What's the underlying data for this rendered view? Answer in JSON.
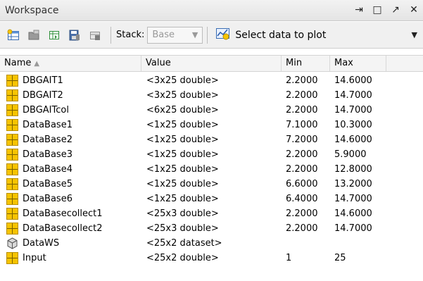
{
  "window": {
    "title": "Workspace",
    "controls": [
      "⇥",
      "□",
      "↗",
      "✕"
    ]
  },
  "toolbar": {
    "icons": [
      "new-variable-icon",
      "open-file-icon",
      "import-data-icon",
      "save-icon",
      "delete-icon"
    ],
    "stack_label": "Stack:",
    "stack_value": "Base",
    "plot_label": "Select data to plot"
  },
  "table": {
    "columns": {
      "name": "Name",
      "value": "Value",
      "min": "Min",
      "max": "Max"
    },
    "rows": [
      {
        "name": "DBGAIT1",
        "value": "<3x25 double>",
        "min": "2.2000",
        "max": "14.6000",
        "icon": "matrix-icon"
      },
      {
        "name": "DBGAIT2",
        "value": "<3x25 double>",
        "min": "2.2000",
        "max": "14.7000",
        "icon": "matrix-icon"
      },
      {
        "name": "DBGAITcol",
        "value": "<6x25 double>",
        "min": "2.2000",
        "max": "14.7000",
        "icon": "matrix-icon"
      },
      {
        "name": "DataBase1",
        "value": "<1x25 double>",
        "min": "7.1000",
        "max": "10.3000",
        "icon": "matrix-icon"
      },
      {
        "name": "DataBase2",
        "value": "<1x25 double>",
        "min": "7.2000",
        "max": "14.6000",
        "icon": "matrix-icon"
      },
      {
        "name": "DataBase3",
        "value": "<1x25 double>",
        "min": "2.2000",
        "max": "5.9000",
        "icon": "matrix-icon"
      },
      {
        "name": "DataBase4",
        "value": "<1x25 double>",
        "min": "2.2000",
        "max": "12.8000",
        "icon": "matrix-icon"
      },
      {
        "name": "DataBase5",
        "value": "<1x25 double>",
        "min": "6.6000",
        "max": "13.2000",
        "icon": "matrix-icon"
      },
      {
        "name": "DataBase6",
        "value": "<1x25 double>",
        "min": "6.4000",
        "max": "14.7000",
        "icon": "matrix-icon"
      },
      {
        "name": "DataBasecollect1",
        "value": "<25x3 double>",
        "min": "2.2000",
        "max": "14.6000",
        "icon": "matrix-icon"
      },
      {
        "name": "DataBasecollect2",
        "value": "<25x3 double>",
        "min": "2.2000",
        "max": "14.7000",
        "icon": "matrix-icon"
      },
      {
        "name": "DataWS",
        "value": "<25x2 dataset>",
        "min": "",
        "max": "",
        "icon": "dataset-icon"
      },
      {
        "name": "Input",
        "value": "<25x2 double>",
        "min": "1",
        "max": "25",
        "icon": "matrix-icon"
      }
    ]
  }
}
